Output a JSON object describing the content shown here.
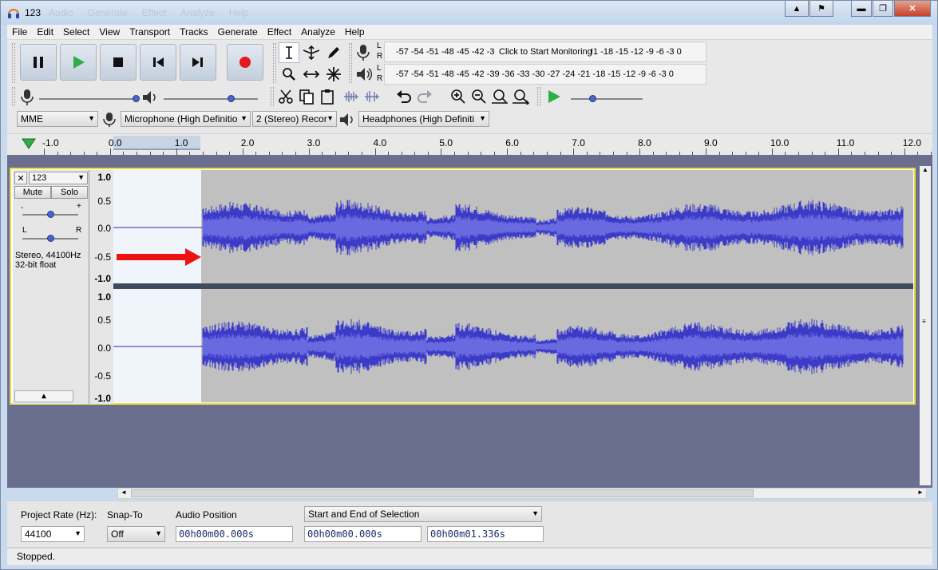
{
  "window": {
    "title": "123",
    "ghost_titles": [
      "Audio",
      "Generate",
      "Effect",
      "Analyze",
      "Help"
    ],
    "controls": {
      "minimize": "▬",
      "restore": "❐",
      "close": "✕"
    }
  },
  "menu": [
    "File",
    "Edit",
    "Select",
    "View",
    "Transport",
    "Tracks",
    "Generate",
    "Effect",
    "Analyze",
    "Help"
  ],
  "transport": {
    "buttons": [
      "pause-icon",
      "play-icon",
      "stop-icon",
      "skip-start-icon",
      "skip-end-icon",
      "record-icon"
    ]
  },
  "tools": [
    "selection-tool-icon",
    "envelope-tool-icon",
    "draw-tool-icon",
    "zoom-tool-icon",
    "timeshift-tool-icon",
    "multi-tool-icon"
  ],
  "meters": {
    "record_scale": "-57 -54 -51 -48 -45 -42 -3",
    "record_click": "Click to Start Monitoring",
    "record_scale_right": "!1 -18 -15 -12  -9  -6  -3  0",
    "play_scale": "-57 -54 -51 -48 -45 -42 -39 -36 -33 -30 -27 -24 -21 -18 -15 -12  -9  -6  -3  0",
    "lr": [
      "L",
      "R"
    ]
  },
  "device": {
    "host": "MME",
    "microphone": "Microphone (High Definitio",
    "channels": "2 (Stereo) Recor",
    "playback": "Headphones (High Definiti"
  },
  "ruler": {
    "labels": [
      "-1.0",
      "0.0",
      "1.0",
      "2.0",
      "3.0",
      "4.0",
      "5.0",
      "6.0",
      "7.0",
      "8.0",
      "9.0",
      "10.0",
      "11.0",
      "12.0"
    ]
  },
  "track": {
    "name": "123",
    "mute": "Mute",
    "solo": "Solo",
    "pan_l": "L",
    "pan_r": "R",
    "gain_minus": "-",
    "gain_plus": "+",
    "info_line1": "Stereo, 44100Hz",
    "info_line2": "32-bit float",
    "vscale": [
      "1.0",
      "0.5",
      "0.0",
      "-0.5",
      "-1.0"
    ],
    "wave_color": "#3b3bc8",
    "wave_light": "#6a6ae0",
    "annotation_color": "#ee1111"
  },
  "selection_toolbar": {
    "project_rate_label": "Project Rate (Hz):",
    "project_rate": "44100",
    "snap_label": "Snap-To",
    "snap_value": "Off",
    "audio_position_label": "Audio Position",
    "audio_position": "00h00m00.000s",
    "selection_mode": "Start and End of Selection",
    "sel_start": "00h00m00.000s",
    "sel_end": "00h00m01.336s"
  },
  "status": "Stopped."
}
